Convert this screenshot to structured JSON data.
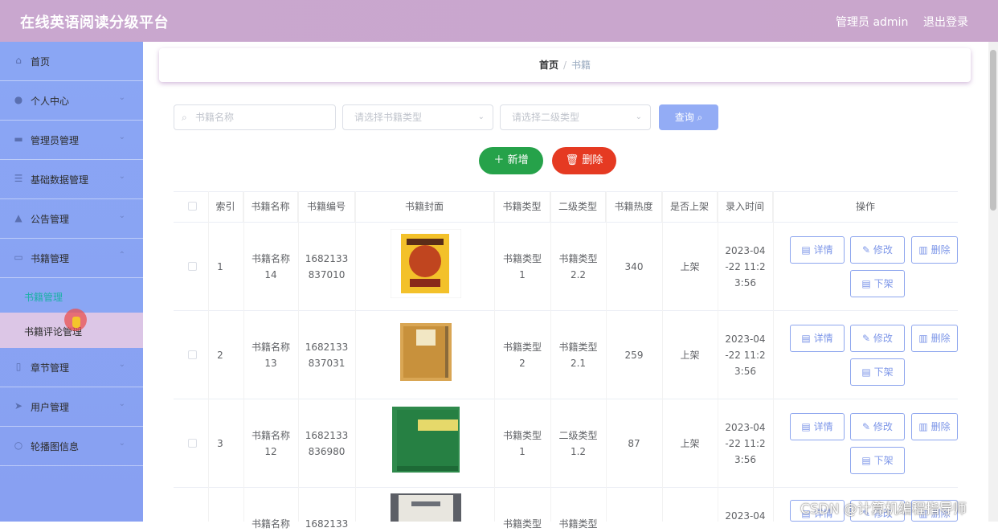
{
  "header": {
    "title": "在线英语阅读分级平台",
    "user": "管理员 admin",
    "logout": "退出登录"
  },
  "sidebar": {
    "items": [
      {
        "label": "首页",
        "icon": "home-icon"
      },
      {
        "label": "个人中心",
        "icon": "user-icon"
      },
      {
        "label": "管理员管理",
        "icon": "admin-icon"
      },
      {
        "label": "基础数据管理",
        "icon": "list-icon"
      },
      {
        "label": "公告管理",
        "icon": "notice-icon"
      },
      {
        "label": "书籍管理",
        "icon": "book-icon"
      },
      {
        "label": "章节管理",
        "icon": "chapter-icon"
      },
      {
        "label": "用户管理",
        "icon": "users-icon"
      },
      {
        "label": "轮播图信息",
        "icon": "carousel-icon"
      }
    ],
    "subitems": [
      {
        "label": "书籍管理",
        "active": true
      },
      {
        "label": "书籍评论管理",
        "active": false
      }
    ]
  },
  "breadcrumb": {
    "home": "首页",
    "separator": "/",
    "current": "书籍"
  },
  "search": {
    "name_placeholder": "书籍名称",
    "type_placeholder": "请选择书籍类型",
    "subtype_placeholder": "请选择二级类型",
    "search_label": "查询"
  },
  "actions": {
    "add_label": "新增",
    "delete_label": "删除"
  },
  "table": {
    "headers": [
      "索引",
      "书籍名称",
      "书籍编号",
      "书籍封面",
      "书籍类型",
      "二级类型",
      "书籍热度",
      "是否上架",
      "录入时间",
      "操作"
    ],
    "rows": [
      {
        "index": "1",
        "name1": "书籍名称",
        "name2": "14",
        "code1": "1682133",
        "code2": "837010",
        "type1": "书籍类型",
        "type2": "1",
        "sub1": "书籍类型",
        "sub2": "2.2",
        "heat": "340",
        "status": "上架",
        "time1": "2023-04",
        "time2": "-22 11:2",
        "time3": "3:56",
        "cover": "yellow"
      },
      {
        "index": "2",
        "name1": "书籍名称",
        "name2": "13",
        "code1": "1682133",
        "code2": "837031",
        "type1": "书籍类型",
        "type2": "2",
        "sub1": "书籍类型",
        "sub2": "2.1",
        "heat": "259",
        "status": "上架",
        "time1": "2023-04",
        "time2": "-22 11:2",
        "time3": "3:56",
        "cover": "tan"
      },
      {
        "index": "3",
        "name1": "书籍名称",
        "name2": "12",
        "code1": "1682133",
        "code2": "836980",
        "type1": "书籍类型",
        "type2": "1",
        "sub1": "二级类型",
        "sub2": "1.2",
        "heat": "87",
        "status": "上架",
        "time1": "2023-04",
        "time2": "-22 11:2",
        "time3": "3:56",
        "cover": "green"
      },
      {
        "index": "",
        "name1": "书籍名称",
        "name2": "",
        "code1": "1682133",
        "code2": "",
        "type1": "书籍类型",
        "type2": "",
        "sub1": "书籍类型",
        "sub2": "",
        "heat": "",
        "status": "",
        "time1": "2023-04",
        "time2": "",
        "time3": "",
        "cover": "gray"
      }
    ],
    "op_labels": {
      "detail": "详情",
      "edit": "修改",
      "delete": "删除",
      "off": "下架"
    }
  },
  "watermark": "CSDN @计算机编程指导师",
  "colors": {
    "header": "#c9a7cf",
    "sidebar": "#8aa6f4",
    "add": "#26a24a",
    "delete": "#e53a22",
    "search": "#93acf5"
  }
}
